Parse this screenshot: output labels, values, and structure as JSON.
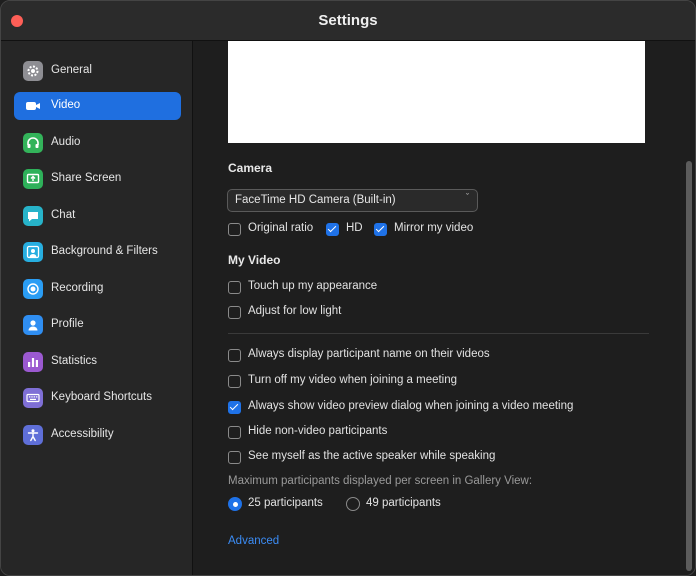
{
  "window": {
    "title": "Settings"
  },
  "sidebar": {
    "items": [
      {
        "label": "General",
        "icon": "gear-icon",
        "color": "#8e8e93",
        "active": false
      },
      {
        "label": "Video",
        "icon": "video-camera-icon",
        "color": "#1f6fe0",
        "active": true
      },
      {
        "label": "Audio",
        "icon": "headphones-icon",
        "color": "#33b35a",
        "active": false
      },
      {
        "label": "Share Screen",
        "icon": "share-screen-icon",
        "color": "#2eb15a",
        "active": false
      },
      {
        "label": "Chat",
        "icon": "chat-bubble-icon",
        "color": "#27b3c9",
        "active": false
      },
      {
        "label": "Background & Filters",
        "icon": "background-portrait-icon",
        "color": "#27aee0",
        "active": false
      },
      {
        "label": "Recording",
        "icon": "record-icon",
        "color": "#2a9df4",
        "active": false
      },
      {
        "label": "Profile",
        "icon": "profile-person-icon",
        "color": "#2f8ef2",
        "active": false
      },
      {
        "label": "Statistics",
        "icon": "bar-chart-icon",
        "color": "#9b59d0",
        "active": false
      },
      {
        "label": "Keyboard Shortcuts",
        "icon": "keyboard-icon",
        "color": "#7f6fd6",
        "active": false
      },
      {
        "label": "Accessibility",
        "icon": "accessibility-icon",
        "color": "#5f6fd8",
        "active": false
      }
    ]
  },
  "camera": {
    "heading": "Camera",
    "selected": "FaceTime HD Camera (Built-in)",
    "options": [
      {
        "label": "Original ratio",
        "checked": false
      },
      {
        "label": "HD",
        "checked": true
      },
      {
        "label": "Mirror my video",
        "checked": true
      }
    ]
  },
  "my_video": {
    "heading": "My Video",
    "options": [
      {
        "label": "Touch up my appearance",
        "checked": false
      },
      {
        "label": "Adjust for low light",
        "checked": false
      }
    ]
  },
  "general_options": [
    {
      "label": "Always display participant name on their videos",
      "checked": false
    },
    {
      "label": "Turn off my video when joining a meeting",
      "checked": false
    },
    {
      "label": "Always show video preview dialog when joining a video meeting",
      "checked": true
    },
    {
      "label": "Hide non-video participants",
      "checked": false
    },
    {
      "label": "See myself as the active speaker while speaking",
      "checked": false
    }
  ],
  "gallery": {
    "hint": "Maximum participants displayed per screen in Gallery View:",
    "options": [
      {
        "label": "25 participants",
        "checked": true
      },
      {
        "label": "49 participants",
        "checked": false
      }
    ]
  },
  "advanced_label": "Advanced",
  "colors": {
    "accent": "#1f6fe0",
    "link": "#3b8cf5",
    "close": "#fe5f57"
  }
}
